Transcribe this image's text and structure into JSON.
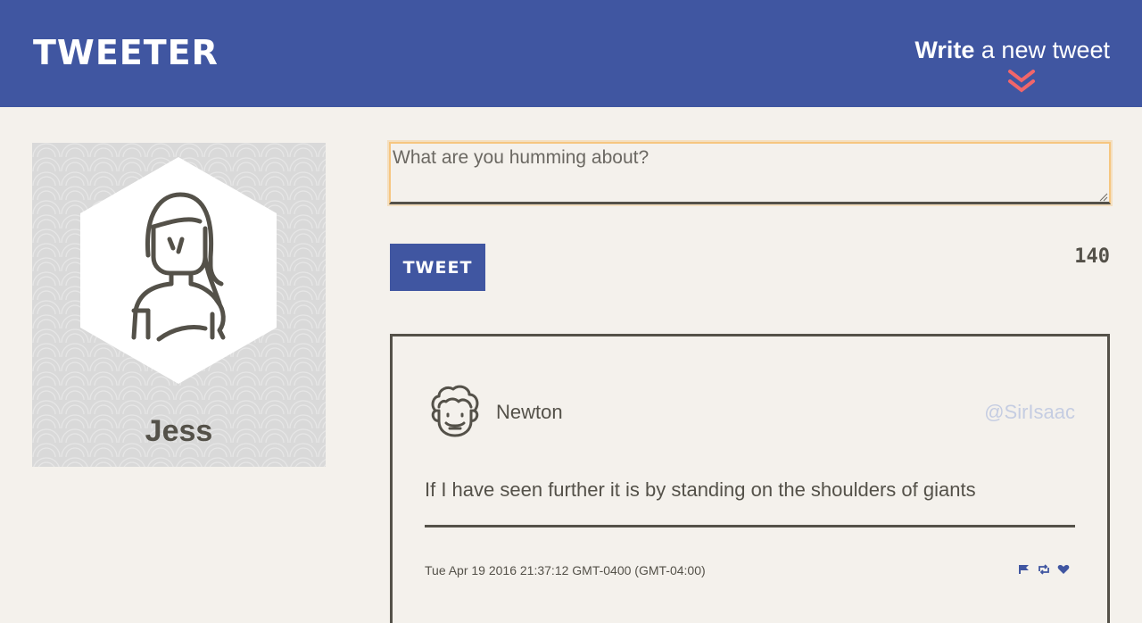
{
  "header": {
    "brand": "TWEETER",
    "compose_bold": "Write",
    "compose_rest": " a new tweet",
    "compose_icon": "double-chevron-down-icon"
  },
  "profile": {
    "name": "Jess",
    "avatar_icon": "woman-avatar-icon"
  },
  "composer": {
    "placeholder": "What are you humming about?",
    "value": "",
    "button_label": "TWEET",
    "char_counter": "140"
  },
  "tweets": [
    {
      "author": "Newton",
      "handle": "@SirIsaac",
      "avatar_icon": "curly-hair-man-avatar-icon",
      "text": "If I have seen further it is by standing on the shoulders of giants",
      "timestamp": "Tue Apr 19 2016 21:37:12 GMT-0400 (GMT-04:00)",
      "actions": [
        "flag-icon",
        "retweet-icon",
        "heart-icon"
      ]
    }
  ],
  "colors": {
    "brand_blue": "#4056a1",
    "accent_red": "#f13c20",
    "background": "#f4f1ec",
    "text_dark": "#545149",
    "handle_light": "#c5cde2",
    "focus_orange": "#f6c680"
  }
}
